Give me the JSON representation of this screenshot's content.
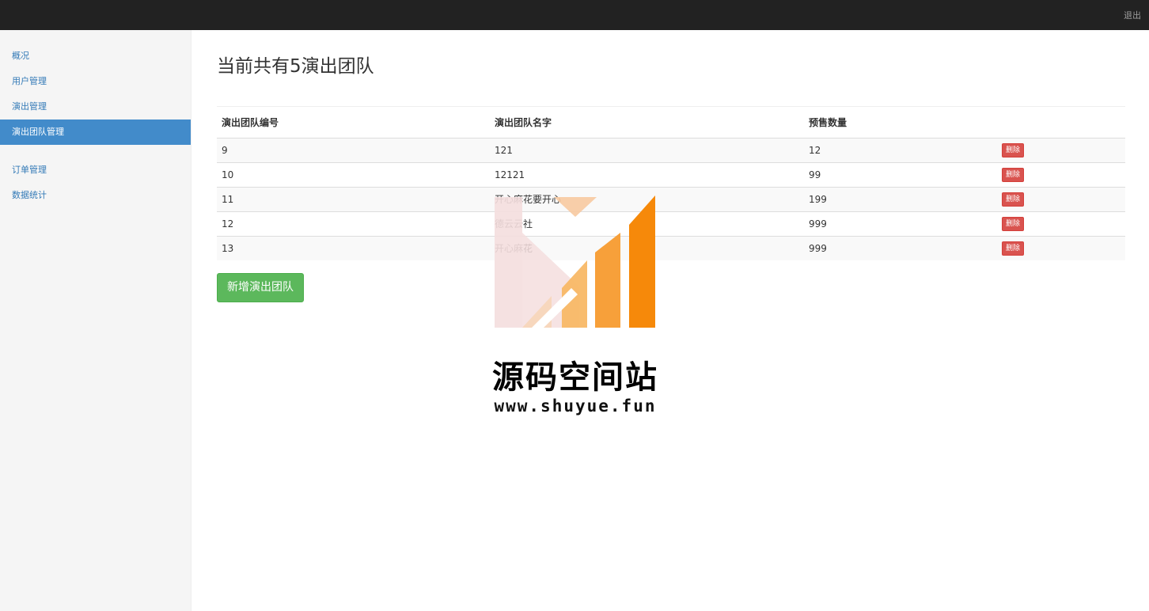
{
  "header": {
    "logout_label": "退出"
  },
  "sidebar": {
    "group1": [
      {
        "label": "概况"
      },
      {
        "label": "用户管理"
      },
      {
        "label": "演出管理"
      },
      {
        "label": "演出团队管理",
        "active": true
      }
    ],
    "group2": [
      {
        "label": "订单管理"
      },
      {
        "label": "数据统计"
      }
    ]
  },
  "main": {
    "title": "当前共有5演出团队",
    "table": {
      "headers": [
        "演出团队编号",
        "演出团队名字",
        "预售数量",
        ""
      ],
      "rows": [
        {
          "id": "9",
          "name": "121",
          "presale": "12",
          "action": "删除"
        },
        {
          "id": "10",
          "name": "12121",
          "presale": "99",
          "action": "删除"
        },
        {
          "id": "11",
          "name": "开心麻花要开心",
          "presale": "199",
          "action": "删除"
        },
        {
          "id": "12",
          "name": "德云云社",
          "presale": "999",
          "action": "删除"
        },
        {
          "id": "13",
          "name": "开心麻花",
          "presale": "999",
          "action": "删除"
        }
      ]
    },
    "add_button": "新增演出团队"
  },
  "watermark": {
    "title": "源码空间站",
    "url": "www.shuyue.fun"
  },
  "colors": {
    "topbar": "#222222",
    "active_nav": "#428bca",
    "danger": "#d9534f",
    "success": "#5cb85c"
  }
}
